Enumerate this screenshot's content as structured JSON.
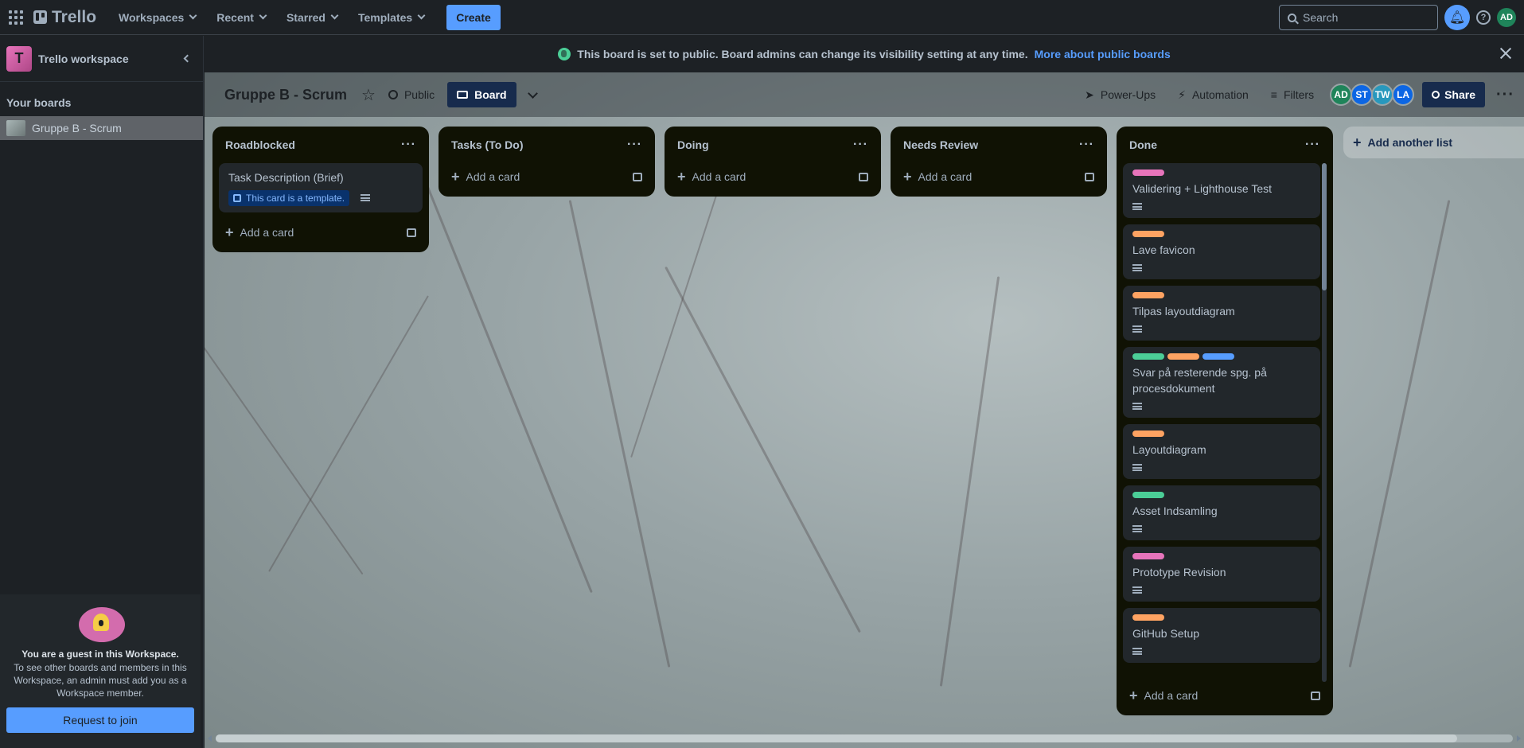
{
  "topnav": {
    "logo": "Trello",
    "items": [
      {
        "label": "Workspaces"
      },
      {
        "label": "Recent"
      },
      {
        "label": "Starred"
      },
      {
        "label": "Templates"
      }
    ],
    "create_label": "Create",
    "search_placeholder": "Search",
    "user_initials": "AD"
  },
  "sidebar": {
    "workspace_initial": "T",
    "workspace_name": "Trello workspace",
    "your_boards_title": "Your boards",
    "boards": [
      {
        "label": "Gruppe B - Scrum"
      }
    ],
    "guest": {
      "title": "You are a guest in this Workspace.",
      "text": "To see other boards and members in this Workspace, an admin must add you as a Workspace member.",
      "join_label": "Request to join"
    }
  },
  "banner": {
    "text": "This board is set to public. Board admins can change its visibility setting at any time.",
    "link": "More about public boards"
  },
  "board_header": {
    "title": "Gruppe B - Scrum",
    "visibility": "Public",
    "view": "Board",
    "powerups": "Power-Ups",
    "automation": "Automation",
    "filters": "Filters",
    "members": [
      {
        "initials": "AD",
        "color": "#1f845a"
      },
      {
        "initials": "ST",
        "color": "#0c66e4"
      },
      {
        "initials": "TW",
        "color": "#2898bd"
      },
      {
        "initials": "LA",
        "color": "#0c66e4"
      }
    ],
    "share": "Share"
  },
  "lists": [
    {
      "title": "Roadblocked",
      "cards": [
        {
          "title": "Task Description (Brief)",
          "template_badge": "This card is a template."
        }
      ],
      "add_label": "Add a card"
    },
    {
      "title": "Tasks (To Do)",
      "cards": [],
      "add_label": "Add a card"
    },
    {
      "title": "Doing",
      "cards": [],
      "add_label": "Add a card"
    },
    {
      "title": "Needs Review",
      "cards": [],
      "add_label": "Add a card"
    },
    {
      "title": "Done",
      "cards": [
        {
          "title": "Validering + Lighthouse Test",
          "labels": [
            "#e774bb"
          ]
        },
        {
          "title": "Lave favicon",
          "labels": [
            "#fea362"
          ]
        },
        {
          "title": "Tilpas layoutdiagram",
          "labels": [
            "#fea362"
          ]
        },
        {
          "title": "Svar på resterende spg. på procesdokument",
          "labels": [
            "#4bce97",
            "#fea362",
            "#579dff"
          ]
        },
        {
          "title": "Layoutdiagram",
          "labels": [
            "#fea362"
          ]
        },
        {
          "title": "Asset Indsamling",
          "labels": [
            "#4bce97"
          ]
        },
        {
          "title": "Prototype Revision",
          "labels": [
            "#e774bb"
          ]
        },
        {
          "title": "GitHub Setup",
          "labels": [
            "#fea362"
          ]
        }
      ],
      "add_label": "Add a card"
    }
  ],
  "add_list_label": "Add another list"
}
